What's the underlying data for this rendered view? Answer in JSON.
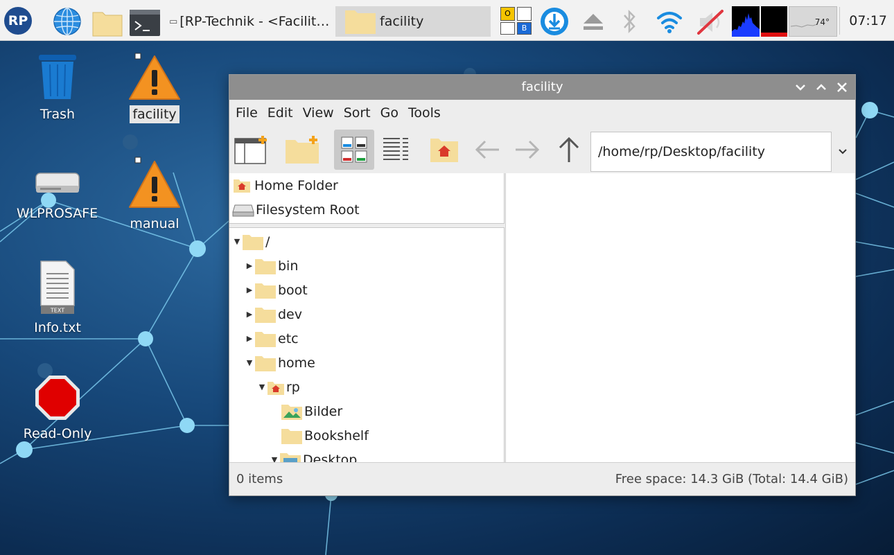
{
  "taskbar": {
    "launcher_logo": "RP",
    "tasks": [
      {
        "label": "[RP-Technik - <Facilit…",
        "active": false
      },
      {
        "label": "facility",
        "active": true
      }
    ],
    "kbd_indicators": [
      "O",
      "B"
    ],
    "temperature": "74°",
    "clock": "07:17"
  },
  "desktop": {
    "icons": [
      {
        "label": "Trash",
        "icon": "trash-icon"
      },
      {
        "label": "facility",
        "icon": "warning-icon",
        "selected": true
      },
      {
        "label": "WLPROSAFE",
        "icon": "drive-icon"
      },
      {
        "label": "manual",
        "icon": "warning-icon"
      },
      {
        "label": "Info.txt",
        "icon": "text-file-icon",
        "badge": "TEXT"
      },
      {
        "label": "Read-Only",
        "icon": "stop-sign-icon"
      }
    ]
  },
  "window": {
    "title": "facility",
    "menu": [
      "File",
      "Edit",
      "View",
      "Sort",
      "Go",
      "Tools"
    ],
    "address": "/home/rp/Desktop/facility",
    "places": [
      "Home Folder",
      "Filesystem Root"
    ],
    "tree": [
      {
        "label": "/",
        "expanded": true
      },
      {
        "label": "bin",
        "expanded": false
      },
      {
        "label": "boot",
        "expanded": false
      },
      {
        "label": "dev",
        "expanded": false
      },
      {
        "label": "etc",
        "expanded": false
      },
      {
        "label": "home",
        "expanded": true
      },
      {
        "label": "rp",
        "expanded": true
      },
      {
        "label": "Bilder"
      },
      {
        "label": "Bookshelf"
      },
      {
        "label": "Desktop",
        "expanded": true
      }
    ],
    "status_left": "0 items",
    "status_right": "Free space: 14.3 GiB (Total: 14.4 GiB)"
  },
  "colors": {
    "taskbar_bg": "#f2f2f2",
    "titlebar_bg": "#8e8e8e",
    "folder": "#f5dd9c",
    "accent_blue": "#1a8ce0"
  }
}
